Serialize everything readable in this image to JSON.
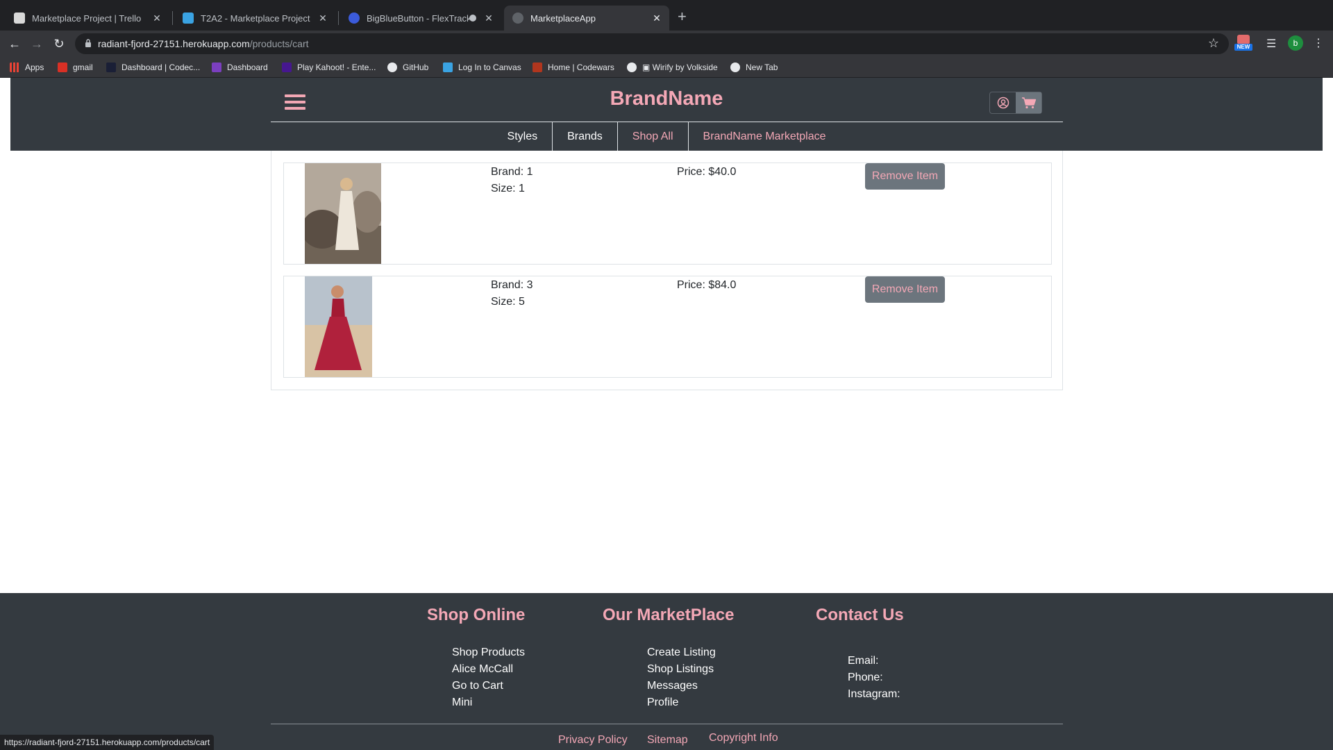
{
  "browser": {
    "tabs": [
      {
        "title": "Marketplace Project | Trello",
        "icon": "trello-icon",
        "color": "#d9d9d9"
      },
      {
        "title": "T2A2 - Marketplace Project",
        "icon": "canvas-a-icon",
        "color": "#3aa3e3"
      },
      {
        "title": "BigBlueButton - FlexTrack - ",
        "icon": "bigbluebutton-icon",
        "color": "#3b5bdb"
      },
      {
        "title": "MarketplaceApp",
        "icon": "globe-icon",
        "color": "#5f6368"
      }
    ],
    "url_host": "radiant-fjord-27151.herokuapp.com",
    "url_path": "/products/cart",
    "bookmarks": [
      {
        "label": "Apps",
        "icon": "apps-grid-icon",
        "color": "#ea4335"
      },
      {
        "label": "gmail",
        "icon": "gmail-icon",
        "color": "#d93025"
      },
      {
        "label": "Dashboard | Codec...",
        "icon": "codecademy-icon",
        "color": "#1a1f36"
      },
      {
        "label": "Dashboard",
        "icon": "ed-icon",
        "color": "#7b3fbf"
      },
      {
        "label": "Play Kahoot! - Ente...",
        "icon": "kahoot-icon",
        "color": "#46178f"
      },
      {
        "label": "GitHub",
        "icon": "github-icon",
        "color": "#e8eaed"
      },
      {
        "label": "Log In to Canvas",
        "icon": "canvas-a-icon",
        "color": "#3aa3e3"
      },
      {
        "label": "Home | Codewars",
        "icon": "codewars-icon",
        "color": "#b1361e"
      },
      {
        "label": "▣ Wirify by Volkside",
        "icon": "globe-icon",
        "color": "#e8eaed"
      },
      {
        "label": "New Tab",
        "icon": "globe-icon",
        "color": "#e8eaed"
      }
    ],
    "profile_initial": "b",
    "ext_badge": "NEW",
    "status_url": "https://radiant-fjord-27151.herokuapp.com/products/cart"
  },
  "header": {
    "brand": "BrandName",
    "nav": [
      {
        "label": "Styles",
        "tone": "white"
      },
      {
        "label": "Brands",
        "tone": "white"
      },
      {
        "label": "Shop All",
        "tone": "pink"
      },
      {
        "label": "BrandName Marketplace",
        "tone": "pink"
      }
    ]
  },
  "cart": {
    "items": [
      {
        "brand": "Brand: 1",
        "size": "Size: 1",
        "price": "Price: $40.0",
        "remove_label": "Remove Item",
        "photo": "cream-dress-photo"
      },
      {
        "brand": "Brand: 3",
        "size": "Size: 5",
        "price": "Price: $84.0",
        "remove_label": "Remove Item",
        "photo": "red-dress-photo"
      }
    ]
  },
  "footer": {
    "shop_online": {
      "title": "Shop Online",
      "links": [
        "Shop Products",
        "Alice McCall",
        "Go to Cart",
        "Mini"
      ]
    },
    "marketplace": {
      "title": "Our MarketPlace",
      "links": [
        "Create Listing",
        "Shop Listings",
        "Messages",
        "Profile"
      ]
    },
    "contact": {
      "title": "Contact Us",
      "lines": [
        "Email:",
        "Phone:",
        "Instagram:"
      ]
    },
    "bottom_links": [
      "Privacy Policy",
      "Sitemap",
      "Copyright Info"
    ]
  },
  "colors": {
    "accent_pink": "#f4a8b6",
    "header_bg": "#343a40",
    "button_gray": "#6c757d"
  }
}
